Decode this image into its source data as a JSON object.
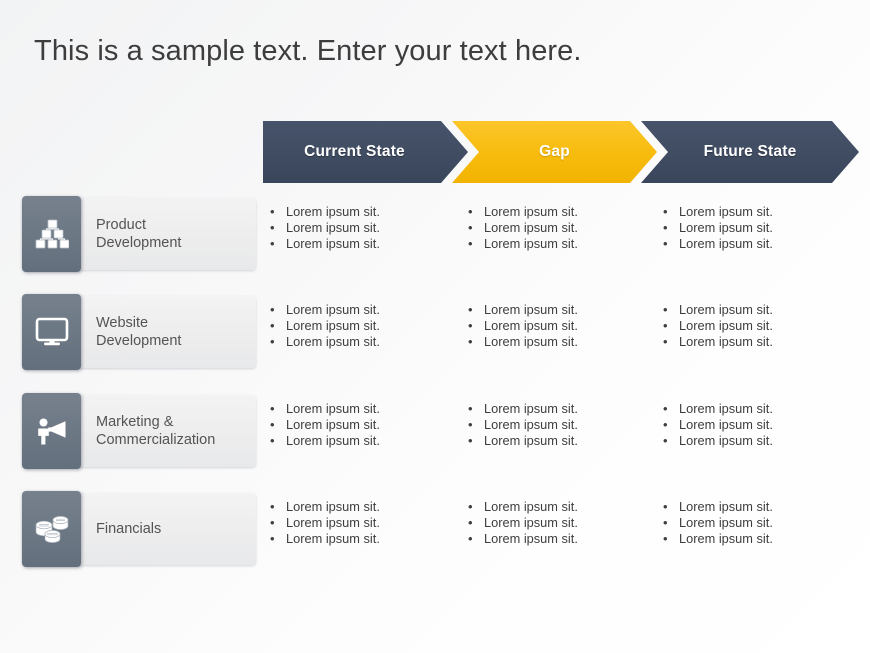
{
  "slide": {
    "title": "This is a sample text. Enter your text here."
  },
  "colors": {
    "navy": "#414d63",
    "gold": "#f8bd11",
    "icon_tile": "#6d7885",
    "card_bg": "#ededee",
    "title_text": "#3d3d3d",
    "body_text": "#3e3e3e",
    "background": "#f7f7f8"
  },
  "header": {
    "columns": [
      {
        "label": "Current State",
        "style": "navy"
      },
      {
        "label": "Gap",
        "style": "gold"
      },
      {
        "label": "Future State",
        "style": "navy"
      }
    ]
  },
  "rows": [
    {
      "label": "Product\nDevelopment",
      "label_line1": "Product",
      "label_line2": "Development",
      "icon": "pyramid-blocks-icon",
      "columns": [
        [
          "Lorem ipsum sit.",
          "Lorem ipsum sit.",
          "Lorem ipsum sit."
        ],
        [
          "Lorem ipsum sit.",
          "Lorem ipsum sit.",
          "Lorem ipsum sit."
        ],
        [
          "Lorem ipsum sit.",
          "Lorem ipsum sit.",
          "Lorem ipsum sit."
        ]
      ]
    },
    {
      "label": "Website\nDevelopment",
      "label_line1": "Website",
      "label_line2": "Development",
      "icon": "monitor-icon",
      "columns": [
        [
          "Lorem ipsum sit.",
          "Lorem ipsum sit.",
          "Lorem ipsum sit."
        ],
        [
          "Lorem ipsum sit.",
          "Lorem ipsum sit.",
          "Lorem ipsum sit."
        ],
        [
          "Lorem ipsum sit.",
          "Lorem ipsum sit.",
          "Lorem ipsum sit."
        ]
      ]
    },
    {
      "label": "Marketing &\nCommercialization",
      "label_line1": "Marketing &",
      "label_line2": "Commercialization",
      "icon": "megaphone-person-icon",
      "columns": [
        [
          "Lorem ipsum sit.",
          "Lorem ipsum sit.",
          "Lorem ipsum sit."
        ],
        [
          "Lorem ipsum sit.",
          "Lorem ipsum sit.",
          "Lorem ipsum sit."
        ],
        [
          "Lorem ipsum sit.",
          "Lorem ipsum sit.",
          "Lorem ipsum sit."
        ]
      ]
    },
    {
      "label": "Financials",
      "label_line1": "Financials",
      "label_line2": "",
      "icon": "coins-icon",
      "columns": [
        [
          "Lorem ipsum sit.",
          "Lorem ipsum sit.",
          "Lorem ipsum sit."
        ],
        [
          "Lorem ipsum sit.",
          "Lorem ipsum sit.",
          "Lorem ipsum sit."
        ],
        [
          "Lorem ipsum sit.",
          "Lorem ipsum sit.",
          "Lorem ipsum sit."
        ]
      ]
    }
  ],
  "bullet_glyph": "•"
}
